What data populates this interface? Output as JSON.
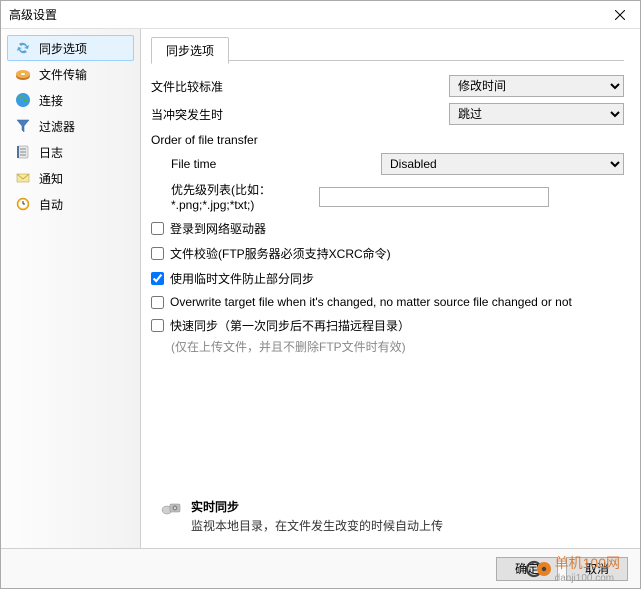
{
  "window": {
    "title": "高级设置"
  },
  "sidebar": {
    "items": [
      {
        "label": "同步选项"
      },
      {
        "label": "文件传输"
      },
      {
        "label": "连接"
      },
      {
        "label": "过滤器"
      },
      {
        "label": "日志"
      },
      {
        "label": "通知"
      },
      {
        "label": "自动"
      }
    ]
  },
  "tab": {
    "label": "同步选项"
  },
  "compare": {
    "label": "文件比较标准",
    "value": "修改时间"
  },
  "conflict": {
    "label": "当冲突发生时",
    "value": "跳过"
  },
  "order": {
    "title": "Order of file transfer",
    "filetime_label": "File time",
    "filetime_value": "Disabled",
    "priority_label": "优先级列表(比如：*.png;*.jpg;*txt;)",
    "priority_value": ""
  },
  "checkboxes": {
    "netdrive": "登录到网络驱动器",
    "verify": "文件校验(FTP服务器必须支持XCRC命令)",
    "tempfile": "使用临时文件防止部分同步",
    "overwrite": "Overwrite target file when it's changed,  no matter source file changed or not",
    "fastsync": "快速同步（第一次同步后不再扫描远程目录）",
    "fastsync_sub": "(仅在上传文件，并且不删除FTP文件时有效)"
  },
  "realtime": {
    "title": "实时同步",
    "desc": "监视本地目录，在文件发生改变的时候自动上传"
  },
  "footer": {
    "ok": "确定",
    "cancel": "取消"
  },
  "watermark": {
    "brand": "单机100网",
    "url": "danji100.com"
  }
}
